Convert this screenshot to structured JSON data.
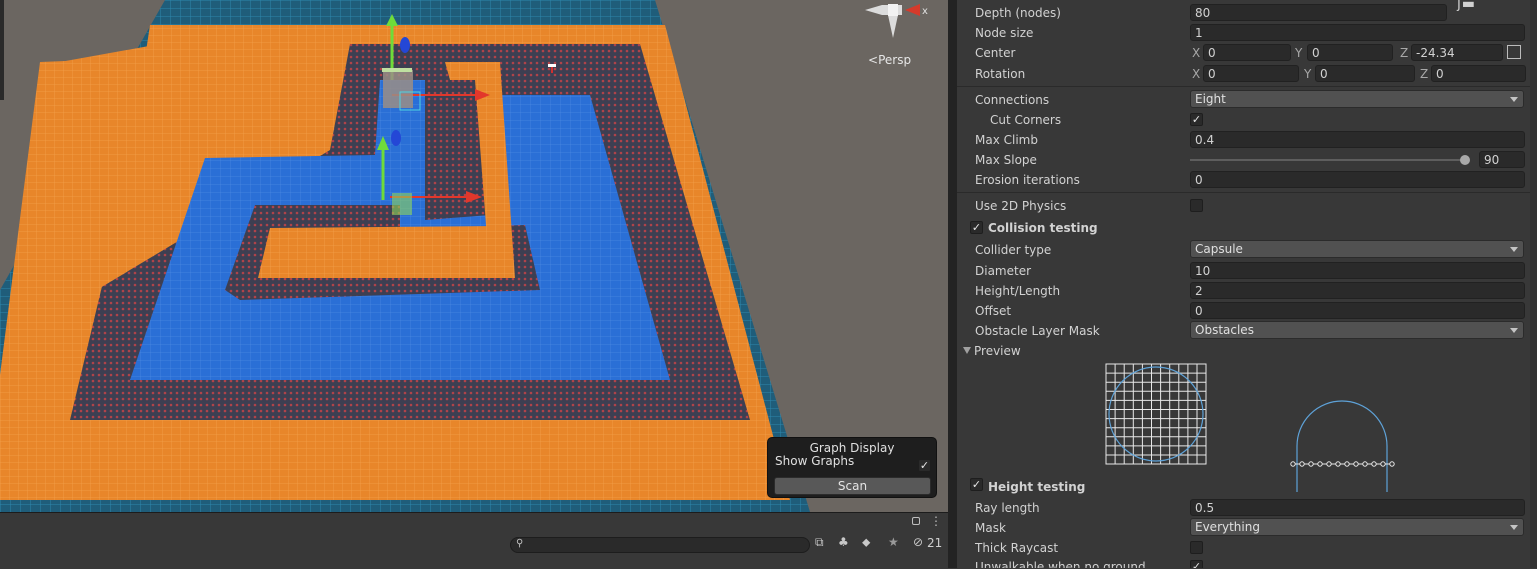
{
  "scene": {
    "persp_label": "Persp",
    "gizmo_axis_label": "x",
    "overlay": {
      "title": "Graph Display",
      "show_graphs_label": "Show Graphs",
      "show_graphs_checked": true,
      "scan_label": "Scan"
    }
  },
  "status_bar": {
    "hidden_count": "21"
  },
  "inspector": {
    "depth_label": "Depth (nodes)",
    "depth_value": "80",
    "node_size_label": "Node size",
    "node_size_value": "1",
    "center_label": "Center",
    "center_x": "0",
    "center_y": "0",
    "center_z": "-24.34",
    "rotation_label": "Rotation",
    "rotation_x": "0",
    "rotation_y": "0",
    "rotation_z": "0",
    "axis_x": "X",
    "axis_y": "Y",
    "axis_z": "Z",
    "connections_label": "Connections",
    "connections_value": "Eight",
    "cut_corners_label": "Cut Corners",
    "cut_corners_checked": true,
    "max_climb_label": "Max Climb",
    "max_climb_value": "0.4",
    "max_slope_label": "Max Slope",
    "max_slope_value": "90",
    "erosion_label": "Erosion iterations",
    "erosion_value": "0",
    "use_2d_label": "Use 2D Physics",
    "use_2d_checked": false,
    "collision_testing_label": "Collision testing",
    "collision_testing_checked": true,
    "collider_type_label": "Collider type",
    "collider_type_value": "Capsule",
    "diameter_label": "Diameter",
    "diameter_value": "10",
    "height_length_label": "Height/Length",
    "height_length_value": "2",
    "offset_label": "Offset",
    "offset_value": "0",
    "obstacle_mask_label": "Obstacle Layer Mask",
    "obstacle_mask_value": "Obstacles",
    "preview_label": "Preview",
    "height_testing_label": "Height testing",
    "height_testing_checked": true,
    "ray_length_label": "Ray length",
    "ray_length_value": "0.5",
    "mask_label": "Mask",
    "mask_value": "Everything",
    "thick_raycast_label": "Thick Raycast",
    "thick_raycast_checked": false,
    "unwalkable_label": "Unwalkable when no ground",
    "unwalkable_checked": true
  }
}
